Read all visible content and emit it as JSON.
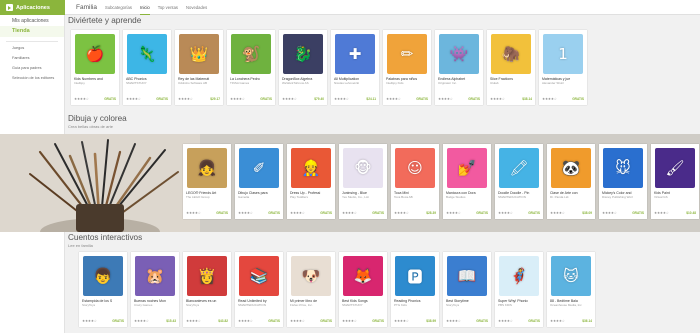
{
  "topbar": {
    "brand": "Aplicaciones",
    "category": "Familia",
    "nav": [
      "Subcategorías",
      "Inicio",
      "Top ventas",
      "Novedades"
    ],
    "active_nav": "Inicio"
  },
  "sidebar": {
    "my_apps": "Mis aplicaciones",
    "store": "Tienda",
    "links": [
      "Juegos",
      "Familiares",
      "Guía para padres",
      "Selección de los editores"
    ]
  },
  "sections": [
    {
      "title": "Diviértete y aprende",
      "subtitle": "",
      "apps": [
        {
          "name": "Kids Numbers and",
          "dev": "Intellijoy",
          "price": "GRATIS",
          "color": "#7cc242",
          "glyph": "🍎"
        },
        {
          "name": "ABC Phonics",
          "dev": "SMARTSTUDY",
          "price": "GRATIS",
          "color": "#3db6e6",
          "glyph": "🦎"
        },
        {
          "name": "Rey de las Matemát",
          "dev": "Oddrobo Software AB",
          "price": "$29.17",
          "color": "#b98a57",
          "glyph": "👑"
        },
        {
          "name": "La Lonchera Pedro",
          "dev": "TINSA Games",
          "price": "GRATIS",
          "color": "#6fb23f",
          "glyph": "🐒"
        },
        {
          "name": "DragonBox Algebra",
          "dev": "WeWantToKnow AS",
          "price": "$79.40",
          "color": "#3b3f63",
          "glyph": "🐉"
        },
        {
          "name": "All Multiplication",
          "dev": "Nicolas Lehovetzki",
          "price": "$24.11",
          "color": "#4f7ad6",
          "glyph": "✚"
        },
        {
          "name": "Palabras para niños",
          "dev": "Intellijoy Kids",
          "price": "GRATIS",
          "color": "#f0a33a",
          "glyph": "✏"
        },
        {
          "name": "Endless Alphabet",
          "dev": "Originator Inc.",
          "price": "GRATIS",
          "color": "#6cb6dd",
          "glyph": "👾"
        },
        {
          "name": "Slice Fractions",
          "dev": "Ululab",
          "price": "$38.14",
          "color": "#f2c13b",
          "glyph": "🦣"
        },
        {
          "name": "Matemáticas y jue",
          "dev": "Alexander Shulz",
          "price": "GRATIS",
          "color": "#9ad0ef",
          "glyph": "1"
        }
      ]
    },
    {
      "title": "Dibuja y colorea",
      "subtitle": "Crea bellas obras de arte",
      "apps": [
        {
          "name": "LEGO® Friends Art",
          "dev": "The LEGO Group",
          "price": "GRATIS",
          "color": "#c7a05b",
          "glyph": "👧"
        },
        {
          "name": "Dibujo Clases para",
          "dev": "Gamelia",
          "price": "GRATIS",
          "color": "#3a8ed6",
          "glyph": "✐"
        },
        {
          "name": "Dress Up - Professi",
          "dev": "Play Toddlers",
          "price": "GRATIS",
          "color": "#e95836",
          "glyph": "👷"
        },
        {
          "name": "Juninsing - Blue",
          "dev": "Yes Studio, Co., Ltd.",
          "price": "GRATIS",
          "color": "#e8e2f0",
          "glyph": "🐵"
        },
        {
          "name": "Toca Mini",
          "dev": "Toca Boca AB",
          "price": "$28.39",
          "color": "#f26b5b",
          "glyph": "☺"
        },
        {
          "name": "Manicura con Dora",
          "dev": "Budge Studios",
          "price": "GRATIS",
          "color": "#f25aa0",
          "glyph": "💅"
        },
        {
          "name": "Doodle Doodle - Pin",
          "dev": "SMARTEDUCATION",
          "price": "GRATIS",
          "color": "#45b3e5",
          "glyph": "🖍"
        },
        {
          "name": "Clase de Arte con",
          "dev": "Dr. Panda Ltd.",
          "price": "$38.09",
          "color": "#f09b2c",
          "glyph": "🐼"
        },
        {
          "name": "Mickey's Color and",
          "dev": "Disney Publishing Worl",
          "price": "GRATIS",
          "color": "#2a6fcf",
          "glyph": "🐭"
        },
        {
          "name": "Kids Paint",
          "dev": "Virtual GS",
          "price": "$10.48",
          "color": "#4a2b8a",
          "glyph": "🖌"
        }
      ]
    },
    {
      "title": "Cuentos interactivos",
      "subtitle": "Lee en familia",
      "apps": [
        {
          "name": "Estampida de los S",
          "dev": "StoryToys",
          "price": "GRATIS",
          "color": "#3d7ab6",
          "glyph": "👦"
        },
        {
          "name": "Buenas noches Mon",
          "dev": "Crazy Games",
          "price": "$15.43",
          "color": "#7a5fb5",
          "glyph": "🐹"
        },
        {
          "name": "Blancanieves es un",
          "dev": "StoryToys",
          "price": "$43.82",
          "color": "#d03b3b",
          "glyph": "👸"
        },
        {
          "name": "Read Unlimited by",
          "dev": "SMARTEDUCATION",
          "price": "GRATIS",
          "color": "#e4473e",
          "glyph": "📚"
        },
        {
          "name": "Mi primer libro de",
          "dev": "Fisher-Price, Inc.",
          "price": "GRATIS",
          "color": "#e8ded3",
          "glyph": "🐶"
        },
        {
          "name": "Best Kids Songs",
          "dev": "SMARTSTUDY",
          "price": "GRATIS",
          "color": "#d8266f",
          "glyph": "🦊"
        },
        {
          "name": "Reading Phonics",
          "dev": "PTG Kids",
          "price": "$38.99",
          "color": "#2d8bcf",
          "glyph": "🅿"
        },
        {
          "name": "Best Storytime",
          "dev": "StoryToys",
          "price": "GRATIS",
          "color": "#3b7ed0",
          "glyph": "📖"
        },
        {
          "name": "Super Why! Phonic",
          "dev": "PBS KIDS",
          "price": "GRATIS",
          "color": "#d9eef8",
          "glyph": "🦸"
        },
        {
          "name": "88 - Bedtime Bala",
          "dev": "Oceanhouse Media, Inc",
          "price": "$36.14",
          "color": "#5cb3e0",
          "glyph": "🐱"
        }
      ]
    }
  ],
  "rating_glyphs": "★★★★☆"
}
